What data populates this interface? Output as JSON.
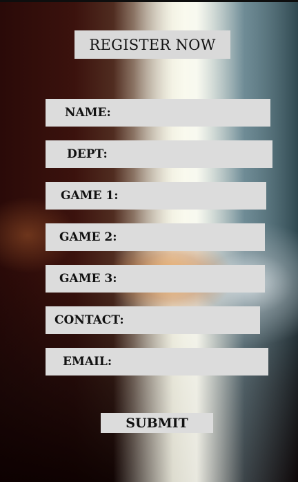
{
  "header": {
    "title": "REGISTER NOW"
  },
  "form": {
    "fields": [
      {
        "label": "NAME:"
      },
      {
        "label": "DEPT:"
      },
      {
        "label": "GAME 1:"
      },
      {
        "label": "GAME 2:"
      },
      {
        "label": "GAME 3:"
      },
      {
        "label": "CONTACT:"
      },
      {
        "label": "EMAIL:"
      }
    ],
    "submit_label": "SUBMIT"
  }
}
